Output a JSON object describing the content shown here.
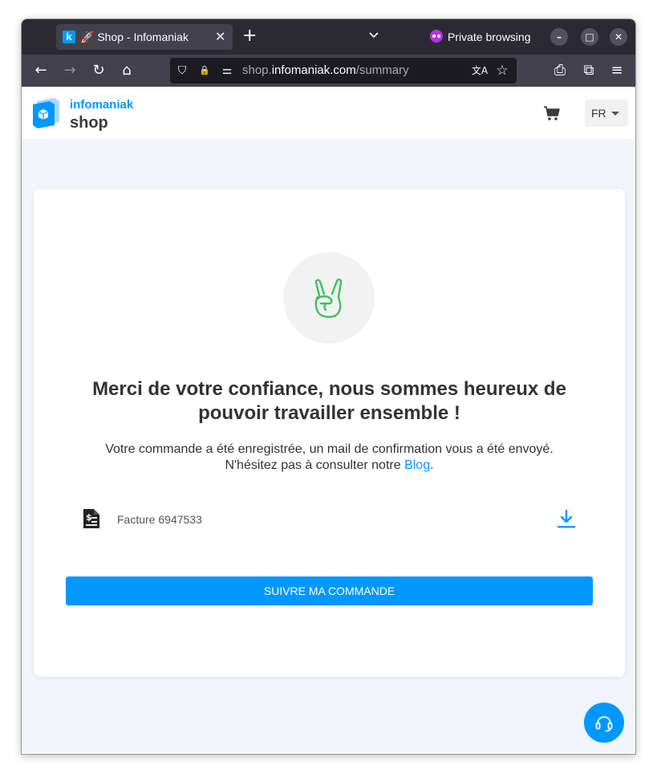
{
  "browser": {
    "tab_favicon": "k",
    "tab_title": "🚀 Shop - Infomaniak",
    "tab_close": "✕",
    "new_tab": "+",
    "private_label": "Private browsing",
    "url_scheme_host": "shop.",
    "url_host": "infomaniak.com",
    "url_path": "/summary",
    "icons": {
      "back": "←",
      "forward": "→",
      "reload": "↻",
      "home": "⌂",
      "shield": "⛉",
      "lock": "🔒",
      "tune": "⚌",
      "translate": "文A",
      "star": "☆",
      "screenshot": "⎙",
      "extensions": "⧉",
      "menu": "≡"
    }
  },
  "site": {
    "brand": "infomaniak",
    "product": "shop",
    "language": "FR"
  },
  "confirmation": {
    "headline": "Merci de votre confiance, nous sommes heureux de pouvoir travailler ensemble !",
    "message_line1": "Votre commande a été enregistrée, un mail de confirmation vous a été envoyé.",
    "message_line2_prefix": "N'hésitez pas à consulter notre ",
    "message_link": "Blog",
    "message_line2_suffix": ".",
    "invoice_label": "Facture 6947533",
    "track_button": "SUIVRE MA COMMANDE"
  },
  "colors": {
    "accent": "#0098ff",
    "success_green": "#3cc15a",
    "page_background": "#f2f5fc"
  }
}
